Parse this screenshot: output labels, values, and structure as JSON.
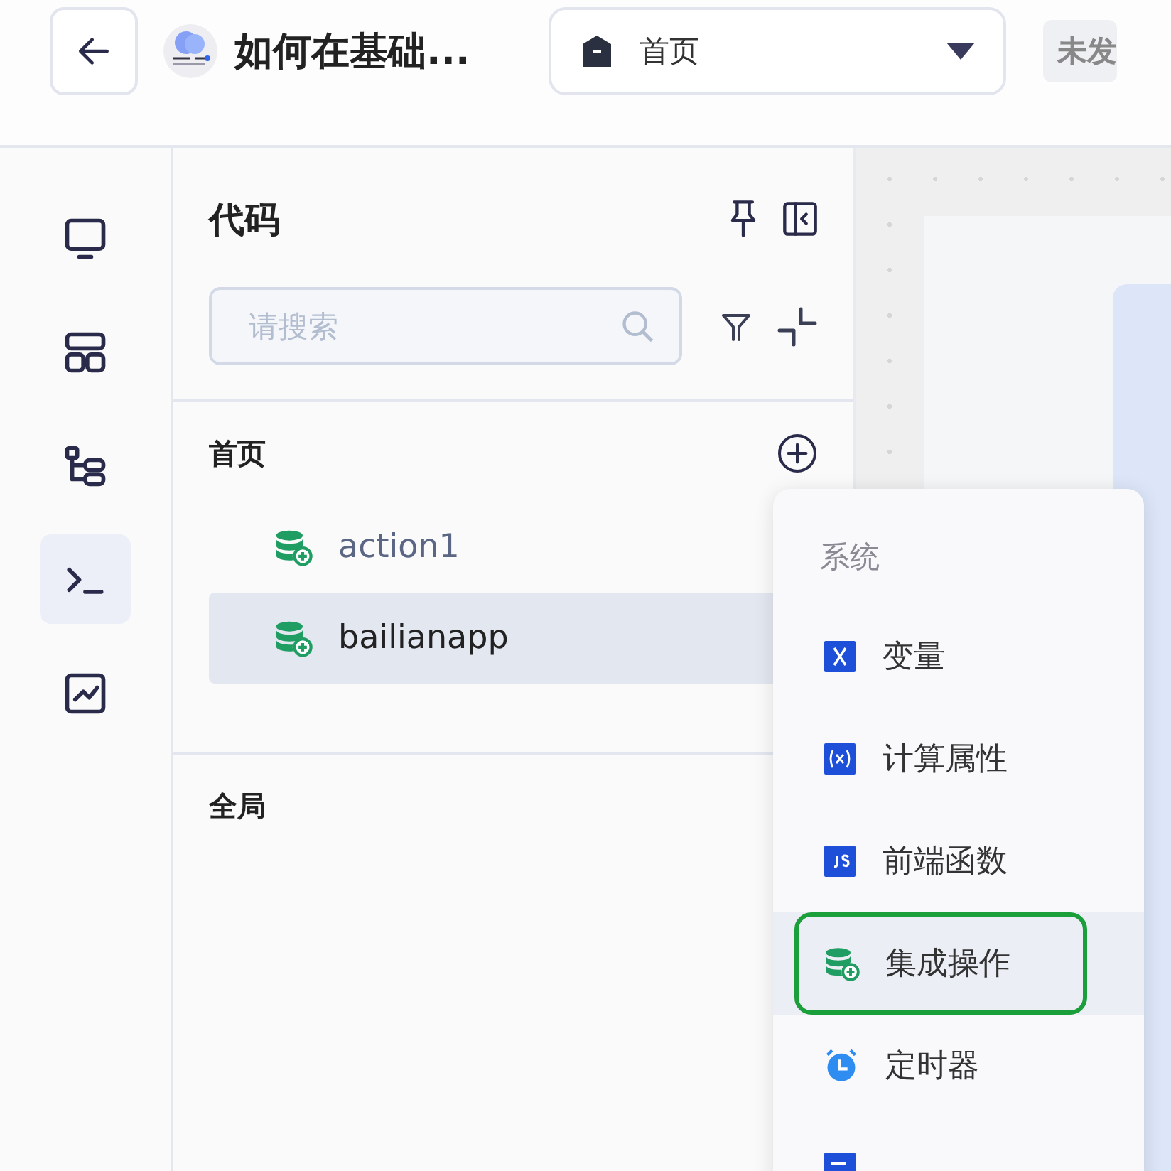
{
  "header": {
    "title": "如何在基础...",
    "page_select": {
      "value": "首页"
    },
    "status_badge": "未发"
  },
  "rail": [
    {
      "kind": "monitor",
      "selected": false
    },
    {
      "kind": "layout",
      "selected": false
    },
    {
      "kind": "tree",
      "selected": false
    },
    {
      "kind": "terminal",
      "selected": true
    },
    {
      "kind": "chart",
      "selected": false
    }
  ],
  "panel": {
    "title": "代码",
    "search": {
      "placeholder": "请搜索"
    },
    "sections": [
      {
        "title": "首页",
        "items": [
          {
            "label": "action1",
            "selected": false
          },
          {
            "label": "bailianapp",
            "selected": true
          }
        ]
      },
      {
        "title": "全局"
      }
    ]
  },
  "menu": {
    "group": "系统",
    "items": [
      {
        "kind": "variable",
        "label": "变量",
        "selected": false
      },
      {
        "kind": "computed",
        "label": "计算属性",
        "selected": false
      },
      {
        "kind": "js",
        "label": "前端函数",
        "selected": false
      },
      {
        "kind": "integration",
        "label": "集成操作",
        "selected": true
      },
      {
        "kind": "timer",
        "label": "定时器",
        "selected": false
      },
      {
        "kind": "flow",
        "selected": false
      }
    ]
  }
}
